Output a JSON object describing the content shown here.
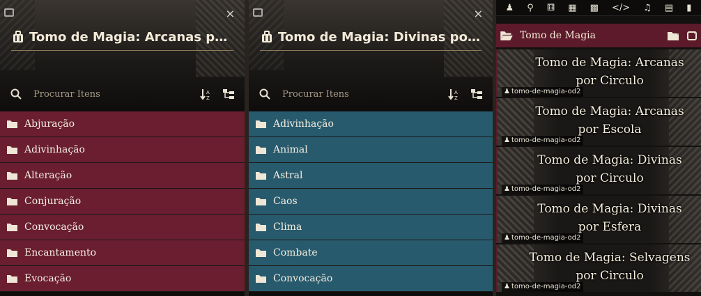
{
  "panels": [
    {
      "title": "Tomo de Magia: Arcanas por Es...",
      "search_placeholder": "Procurar Itens",
      "folders": [
        "Abjuração",
        "Adivinhação",
        "Alteração",
        "Conjuração",
        "Convocação",
        "Encantamento",
        "Evocação"
      ]
    },
    {
      "title": "Tomo de Magia: Divinas por Esf...",
      "search_placeholder": "Procurar Itens",
      "folders": [
        "Adivinhação",
        "Animal",
        "Astral",
        "Caos",
        "Clima",
        "Combate",
        "Convocação"
      ]
    }
  ],
  "right_panel": {
    "folder_label": "Tomo de Magia",
    "entries": [
      {
        "title": "Tomo de Magia: Arcanas por Circulo",
        "source": "tomo-de-magia-od2"
      },
      {
        "title": "Tomo de Magia: Arcanas por Escola",
        "source": "tomo-de-magia-od2"
      },
      {
        "title": "Tomo de Magia: Divinas por Circulo",
        "source": "tomo-de-magia-od2"
      },
      {
        "title": "Tomo de Magia: Divinas por Esfera",
        "source": "tomo-de-magia-od2"
      },
      {
        "title": "Tomo de Magia: Selvagens por Circulo",
        "source": "tomo-de-magia-od2"
      }
    ],
    "toolbar_icons": [
      "user-icon",
      "pin-icon",
      "dice-icon",
      "scroll-icon",
      "book-icon",
      "code-icon",
      "music-icon",
      "table-icon",
      "compendium-icon"
    ]
  },
  "colors": {
    "arcane_row": "#6a1e30",
    "divine_row": "#285a6d"
  }
}
